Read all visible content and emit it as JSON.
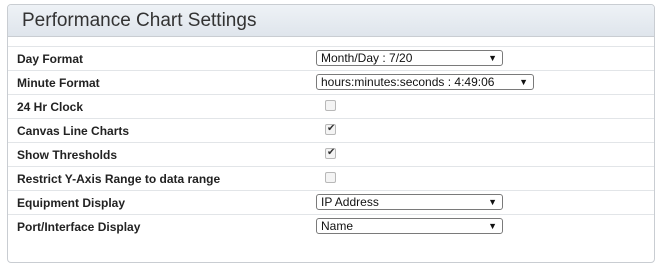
{
  "panel": {
    "title": "Performance Chart Settings"
  },
  "settings": [
    {
      "label": "Day Format",
      "control": "select",
      "value": "Month/Day : 7/20"
    },
    {
      "label": "Minute Format",
      "control": "select",
      "value": "hours:minutes:seconds : 4:49:06"
    },
    {
      "label": "24 Hr Clock",
      "control": "checkbox",
      "checked": false
    },
    {
      "label": "Canvas Line Charts",
      "control": "checkbox",
      "checked": true
    },
    {
      "label": "Show Thresholds",
      "control": "checkbox",
      "checked": true
    },
    {
      "label": "Restrict Y-Axis Range to data range",
      "control": "checkbox",
      "checked": false
    },
    {
      "label": "Equipment Display",
      "control": "select",
      "value": "IP Address"
    },
    {
      "label": "Port/Interface Display",
      "control": "select",
      "value": "Name"
    }
  ],
  "icons": {
    "dropdown_arrow": "▼",
    "checkmark": "✔"
  }
}
